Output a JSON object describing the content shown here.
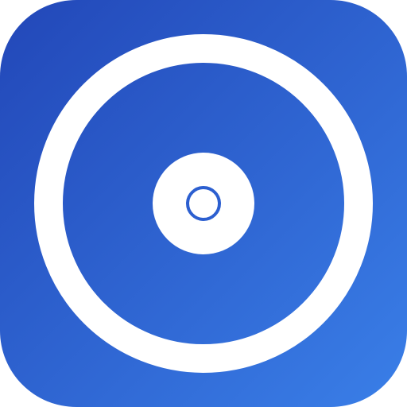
{
  "icon": {
    "name": "disc-icon",
    "colors": {
      "gradient_start": "#2247b8",
      "gradient_end": "#3a7fe8",
      "disc": "#ffffff",
      "hole_ring": "#2c5fd0"
    }
  }
}
